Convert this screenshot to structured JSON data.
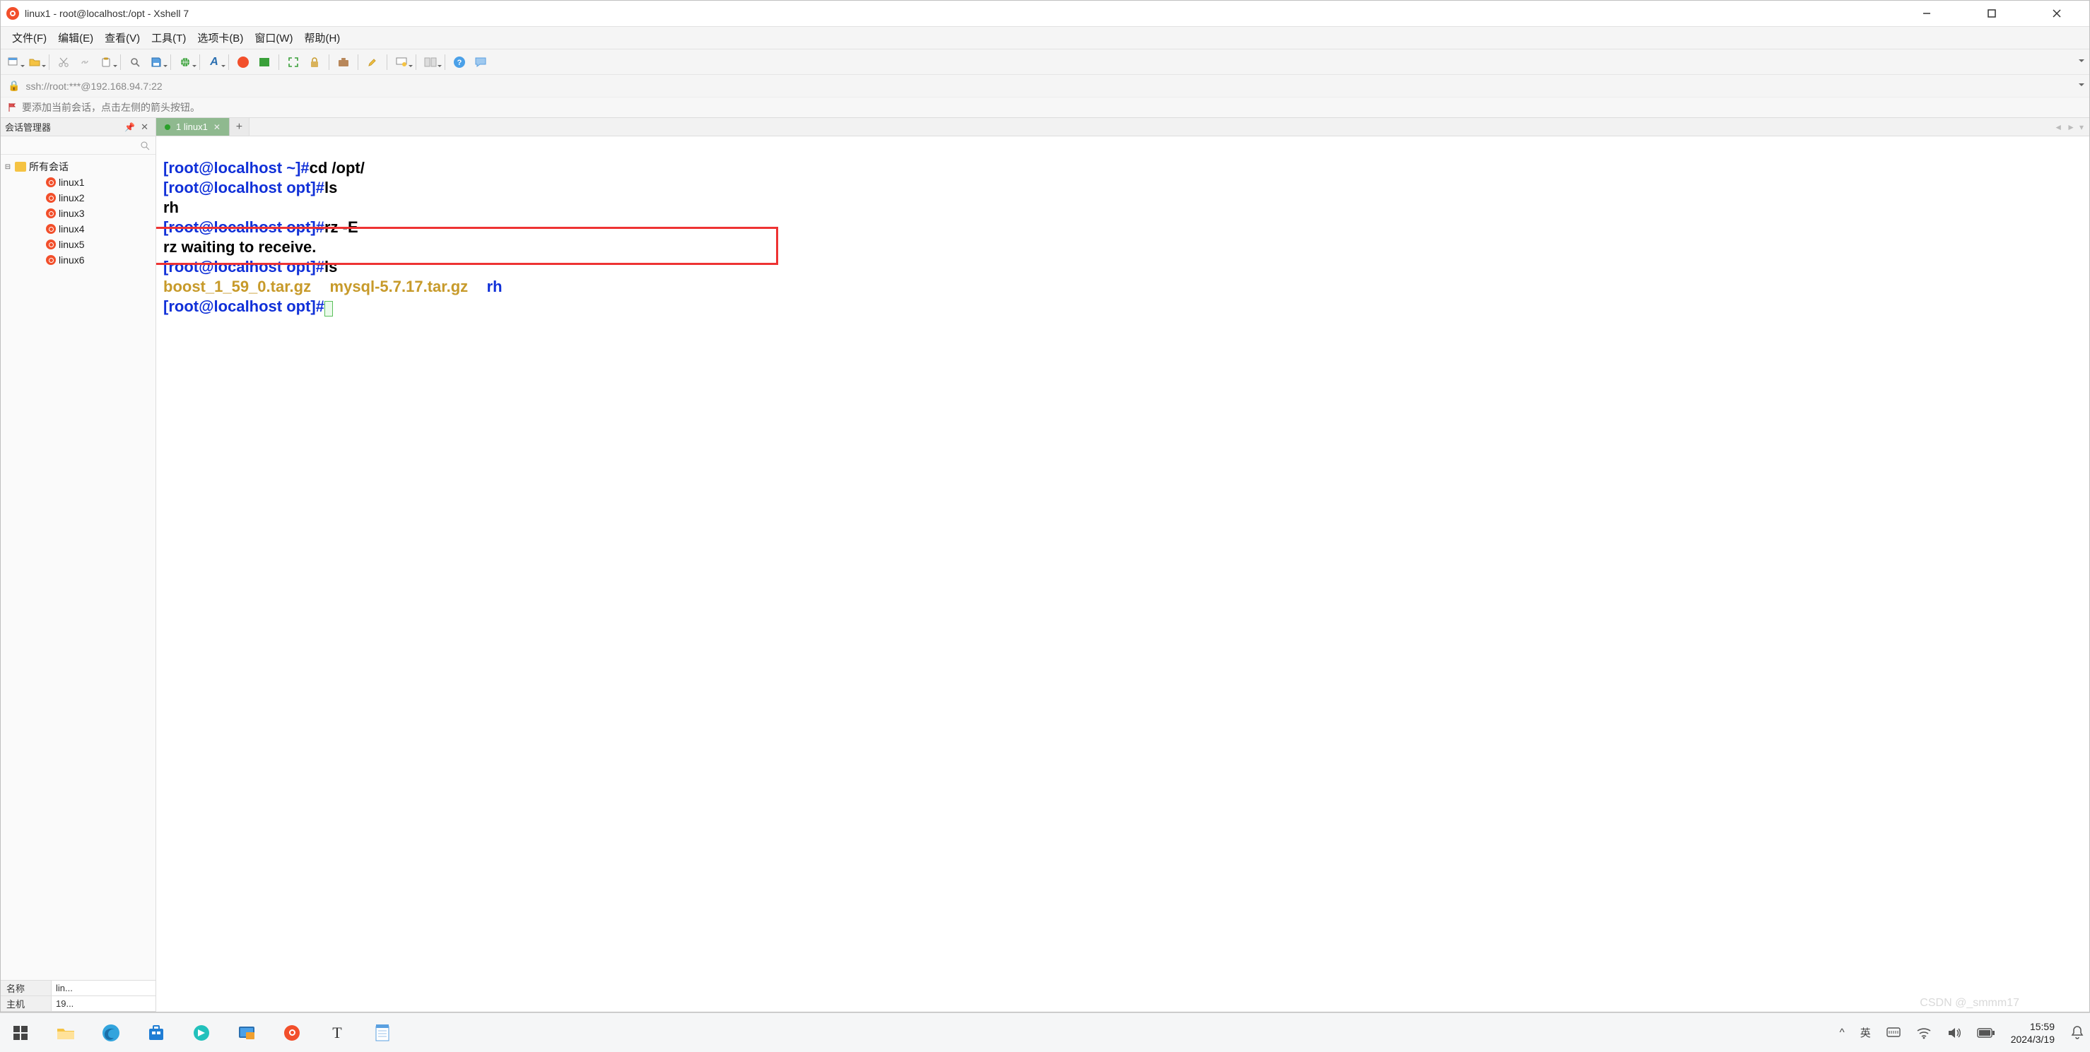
{
  "window": {
    "title": "linux1 - root@localhost:/opt - Xshell 7"
  },
  "menu": {
    "file": "文件(F)",
    "edit": "编辑(E)",
    "view": "查看(V)",
    "tools": "工具(T)",
    "tabs": "选项卡(B)",
    "window": "窗口(W)",
    "help": "帮助(H)"
  },
  "addressbar": {
    "url": "ssh://root:***@192.168.94.7:22"
  },
  "hintbar": {
    "text": "要添加当前会话，点击左侧的箭头按钮。"
  },
  "session_panel": {
    "title": "会话管理器",
    "root": "所有会话",
    "items": [
      "linux1",
      "linux2",
      "linux3",
      "linux4",
      "linux5",
      "linux6"
    ],
    "footer": {
      "name_label": "名称",
      "name_value": "lin...",
      "host_label": "主机",
      "host_value": "19..."
    }
  },
  "tab": {
    "label": "1 linux1",
    "add": "+"
  },
  "terminal": {
    "l1_prompt": "[root@localhost ~]#",
    "l1_cmd": "cd /opt/",
    "l2_prompt": "[root@localhost opt]#",
    "l2_cmd": "ls",
    "l3": "rh",
    "l4_cmd": "rz -E",
    "l5": "rz waiting to receive.",
    "l6_cmd": "ls",
    "l7_a": "boost_1_59_0.tar.gz",
    "l7_b": "mysql-5.7.17.tar.gz",
    "l7_rh": "rh",
    "l8_prompt": "[root@localhost opt]#"
  },
  "systray": {
    "chevron": "^",
    "ime1": "英",
    "time": "15:59",
    "date": "2024/3/19"
  },
  "watermark": "CSDN @_smmm17"
}
